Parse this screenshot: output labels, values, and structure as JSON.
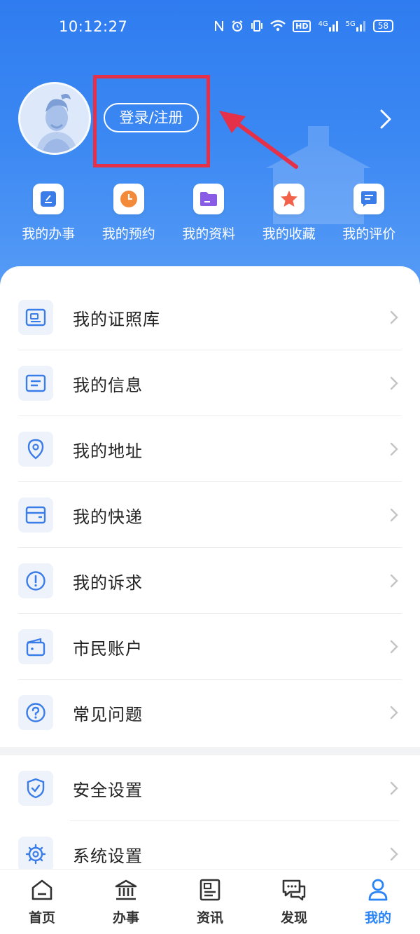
{
  "status_bar": {
    "time": "10:12:27",
    "network_4g": "4G",
    "network_5g": "5G",
    "hd": "HD",
    "battery": "58"
  },
  "profile": {
    "login_label": "登录/注册",
    "avatar_icon": "avatar-icon"
  },
  "quick_actions": [
    {
      "label": "我的办事",
      "icon": "edit-doc-icon",
      "color": "#3b7de8"
    },
    {
      "label": "我的预约",
      "icon": "clock-icon",
      "color": "#f28a3a"
    },
    {
      "label": "我的资料",
      "icon": "folder-icon",
      "color": "#8a5ce6"
    },
    {
      "label": "我的收藏",
      "icon": "star-icon",
      "color": "#f2614a"
    },
    {
      "label": "我的评价",
      "icon": "comment-icon",
      "color": "#3b7de8"
    }
  ],
  "menu": [
    {
      "label": "我的证照库",
      "icon": "id-card-icon"
    },
    {
      "label": "我的信息",
      "icon": "info-card-icon"
    },
    {
      "label": "我的地址",
      "icon": "location-pin-icon"
    },
    {
      "label": "我的快递",
      "icon": "package-box-icon"
    },
    {
      "label": "我的诉求",
      "icon": "exclamation-circle-icon"
    },
    {
      "label": "市民账户",
      "icon": "wallet-icon"
    },
    {
      "label": "常见问题",
      "icon": "question-circle-icon"
    }
  ],
  "settings_menu": [
    {
      "label": "安全设置",
      "icon": "shield-check-icon"
    },
    {
      "label": "系统设置",
      "icon": "gear-icon"
    }
  ],
  "tabbar": [
    {
      "label": "首页",
      "icon": "home-icon",
      "active": false
    },
    {
      "label": "办事",
      "icon": "government-building-icon",
      "active": false
    },
    {
      "label": "资讯",
      "icon": "news-icon",
      "active": false
    },
    {
      "label": "发现",
      "icon": "chat-bubbles-icon",
      "active": false
    },
    {
      "label": "我的",
      "icon": "person-icon",
      "active": true
    }
  ],
  "colors": {
    "header_blue": "#2f7cf0",
    "accent_blue": "#2a84f5",
    "annotation_red": "#e5304a",
    "menu_icon_blue": "#3b7de8"
  }
}
